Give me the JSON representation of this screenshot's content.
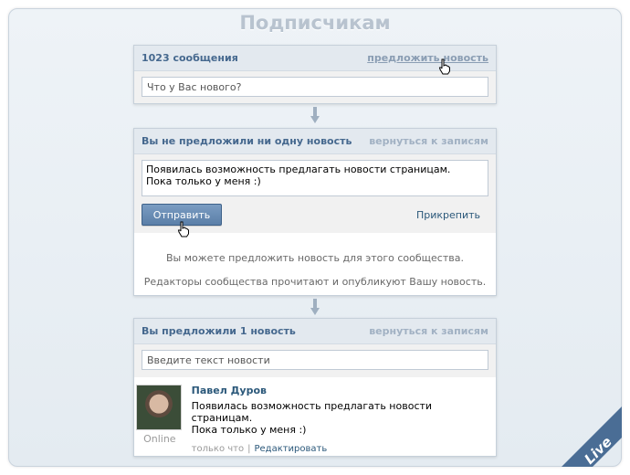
{
  "page_title": "Подписчикам",
  "panel1": {
    "count_label": "1023 сообщения",
    "suggest_link": "предложить новость",
    "status_placeholder": "Что у Вас нового?"
  },
  "panel2": {
    "header_title": "Вы не предложили ни одну новость",
    "back_link": "вернуться к записям",
    "textarea_line1": "Появилась возможность предлагать новости страницам.",
    "textarea_line2": "Пока только у меня :)",
    "send_label": "Отправить",
    "attach_label": "Прикрепить",
    "info_line1": "Вы можете предложить новость для этого сообщества.",
    "info_line2": "Редакторы сообщества прочитают и опубликуют Вашу новость."
  },
  "panel3": {
    "header_title": "Вы предложили 1 новость",
    "back_link": "вернуться к записям",
    "news_placeholder": "Введите текст новости",
    "post": {
      "author": "Павел Дуров",
      "line1": "Появилась возможность предлагать новости страницам.",
      "line2": "Пока только у меня :)",
      "online": "Online",
      "time": "только что",
      "edit_link": "Редактировать"
    }
  },
  "badge": {
    "text": "Live",
    "color": "#4a6d95"
  },
  "icons": [
    "arrow-down-icon",
    "hand-cursor-icon"
  ],
  "colors": {
    "link": "#2b587a",
    "header_bg": "#e3e9ef",
    "title": "#b8c3cf"
  }
}
